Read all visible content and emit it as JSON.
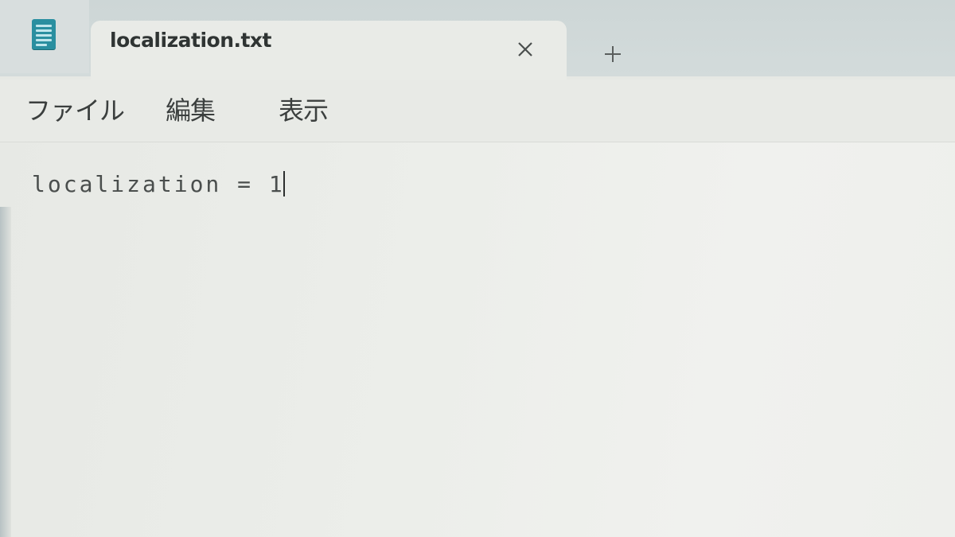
{
  "tab": {
    "title": "localization.txt",
    "close_icon": "close-icon",
    "new_tab_icon": "plus-icon"
  },
  "menu": {
    "file": "ファイル",
    "edit": "編集",
    "view": "表示"
  },
  "editor": {
    "content": "localization = 1"
  },
  "colors": {
    "accent": "#2a8fa0",
    "text": "#3b3f3e"
  }
}
